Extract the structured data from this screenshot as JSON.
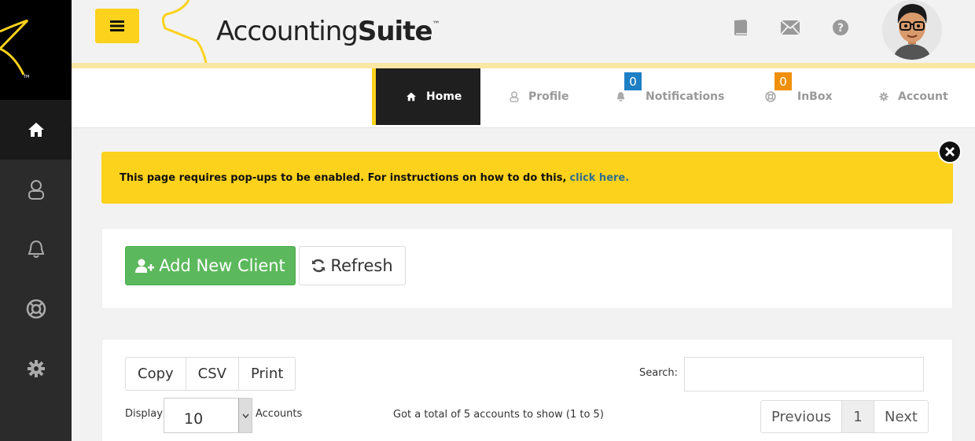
{
  "app": {
    "name_regular": "Accounting",
    "name_bold": "Suite",
    "trademark": "™"
  },
  "header": {
    "icons": [
      "book-icon",
      "envelope-icon",
      "question-circle-icon"
    ],
    "avatar": "user-avatar"
  },
  "sidebar": {
    "items": [
      {
        "icon": "home-icon",
        "active": true
      },
      {
        "icon": "user-icon",
        "active": false
      },
      {
        "icon": "bell-icon",
        "active": false
      },
      {
        "icon": "lifebuoy-icon",
        "active": false
      },
      {
        "icon": "gear-icon",
        "active": false
      }
    ]
  },
  "nav": {
    "tabs": [
      {
        "label": "Home",
        "icon": "home-icon",
        "active": true
      },
      {
        "label": "Profile",
        "icon": "user-icon"
      },
      {
        "label": "Notifications",
        "icon": "bell-icon",
        "badge": "0",
        "badge_color": "#1e7fc4"
      },
      {
        "label": "InBox",
        "icon": "lifebuoy-icon",
        "badge": "0",
        "badge_color": "#f0900a"
      },
      {
        "label": "Account",
        "icon": "gear-icon"
      }
    ]
  },
  "alert": {
    "text": "This page requires pop-ups to be enabled. For instructions on how to do this,",
    "link": "click here."
  },
  "actions": {
    "add_label": "Add New Client",
    "refresh_label": "Refresh"
  },
  "table_tools": {
    "buttons": [
      "Copy",
      "CSV",
      "Print"
    ],
    "search_label": "Search:",
    "search_value": "",
    "display_label": "Display",
    "page_size": "10",
    "accounts_label": "Accounts",
    "info": "Got a total of 5 accounts to show (1 to 5)",
    "pager": {
      "prev": "Previous",
      "current": "1",
      "next": "Next"
    }
  },
  "colors": {
    "brand_yellow": "#fcd21c",
    "sidebar_dark": "#2b2b2b",
    "success_green": "#5cb85c",
    "link_blue": "#2f6f8f"
  }
}
